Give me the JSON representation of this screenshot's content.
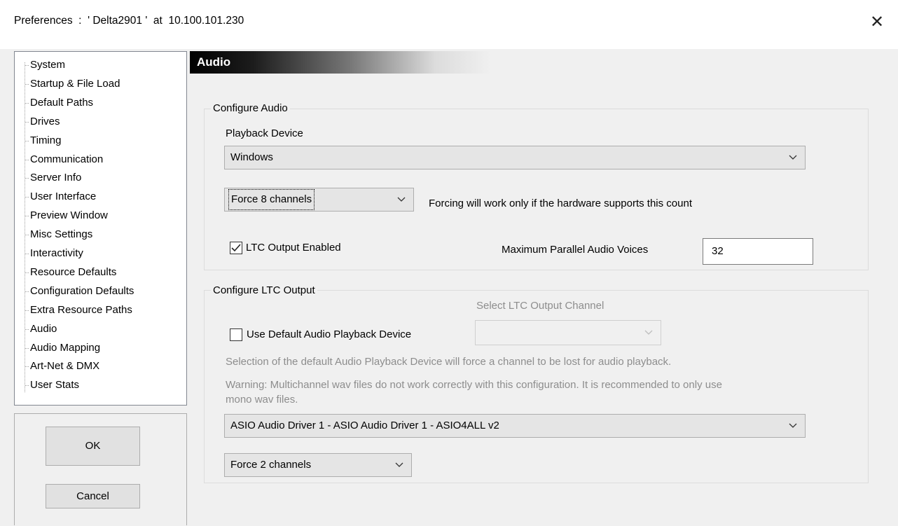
{
  "window": {
    "title": "Preferences  :  ' Delta2901 '  at  10.100.101.230",
    "close_symbol": "✕"
  },
  "tree": {
    "items": [
      {
        "label": "System"
      },
      {
        "label": "Startup & File Load"
      },
      {
        "label": "Default Paths"
      },
      {
        "label": "Drives"
      },
      {
        "label": "Timing"
      },
      {
        "label": "Communication"
      },
      {
        "label": "Server Info"
      },
      {
        "label": "User Interface"
      },
      {
        "label": "Preview Window"
      },
      {
        "label": "Misc Settings"
      },
      {
        "label": "Interactivity"
      },
      {
        "label": "Resource Defaults"
      },
      {
        "label": "Configuration Defaults"
      },
      {
        "label": "Extra Resource Paths"
      },
      {
        "label": "Audio"
      },
      {
        "label": "Audio Mapping"
      },
      {
        "label": "Art-Net & DMX"
      },
      {
        "label": "User Stats"
      }
    ],
    "selected": "Audio"
  },
  "buttons": {
    "ok": "OK",
    "cancel": "Cancel"
  },
  "section": {
    "title": "Audio"
  },
  "configure_audio": {
    "legend": "Configure Audio",
    "playback_device_label": "Playback Device",
    "playback_device_value": "Windows",
    "force_channels_value": "Force 8 channels",
    "force_note": "Forcing will work only if the hardware supports this count",
    "ltc_output_enabled_label": "LTC Output Enabled",
    "ltc_output_enabled_checked": true,
    "max_voices_label": "Maximum Parallel Audio Voices",
    "max_voices_value": "32"
  },
  "configure_ltc": {
    "legend": "Configure LTC Output",
    "select_channel_label": "Select LTC Output Channel",
    "select_channel_value": "",
    "use_default_label": "Use Default Audio Playback Device",
    "use_default_checked": false,
    "note_selection": "Selection of the default Audio Playback Device will force a channel to be lost for audio playback.",
    "warning_line1": "Warning: Multichannel wav files do not work correctly with this configuration. It is recommended to only use",
    "warning_line2": "mono wav files.",
    "driver_value": "ASIO Audio Driver 1 - ASIO Audio Driver 1 - ASIO4ALL v2",
    "force_channels_value": "Force 2 channels"
  },
  "colors": {
    "disabled_text": "#8d8d8d",
    "dropdown_bg": "#e5e5e5"
  }
}
